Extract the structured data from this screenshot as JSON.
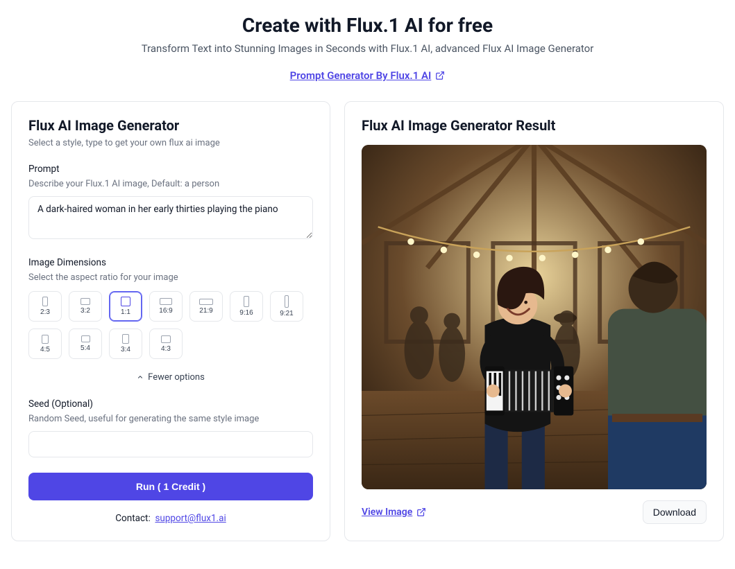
{
  "header": {
    "title": "Create with Flux.1 AI for free",
    "subtitle": "Transform Text into Stunning Images in Seconds with Flux.1 AI, advanced Flux AI Image Generator",
    "prompt_gen_link": "Prompt Generator By Flux.1 AI"
  },
  "left": {
    "title": "Flux AI Image Generator",
    "desc": "Select a style, type to get your own flux ai image",
    "prompt": {
      "label": "Prompt",
      "sub": "Describe your Flux.1 AI image, Default: a person",
      "value": "A dark-haired woman in her early thirties playing the piano"
    },
    "dimensions": {
      "label": "Image Dimensions",
      "sub": "Select the aspect ratio for your image",
      "selected": "1:1",
      "options": [
        {
          "label": "2:3",
          "w": 8,
          "h": 14
        },
        {
          "label": "3:2",
          "w": 14,
          "h": 10
        },
        {
          "label": "1:1",
          "w": 14,
          "h": 14
        },
        {
          "label": "16:9",
          "w": 18,
          "h": 10
        },
        {
          "label": "21:9",
          "w": 20,
          "h": 9
        },
        {
          "label": "9:16",
          "w": 8,
          "h": 16
        },
        {
          "label": "9:21",
          "w": 6,
          "h": 18
        },
        {
          "label": "4:5",
          "w": 10,
          "h": 13
        },
        {
          "label": "5:4",
          "w": 13,
          "h": 10
        },
        {
          "label": "3:4",
          "w": 10,
          "h": 14
        },
        {
          "label": "4:3",
          "w": 14,
          "h": 11
        }
      ]
    },
    "fewer_label": "Fewer options",
    "seed": {
      "label": "Seed (Optional)",
      "sub": "Random Seed, useful for generating the same style image",
      "value": ""
    },
    "run_label": "Run   ( 1 Credit )",
    "contact_label": "Contact:",
    "contact_email": "support@flux1.ai"
  },
  "right": {
    "title": "Flux AI Image Generator Result",
    "view_label": "View Image",
    "download_label": "Download",
    "image_alt": "A smiling dark-haired woman playing an accordion inside a wooden pavilion with string lights; people dancing around her."
  }
}
